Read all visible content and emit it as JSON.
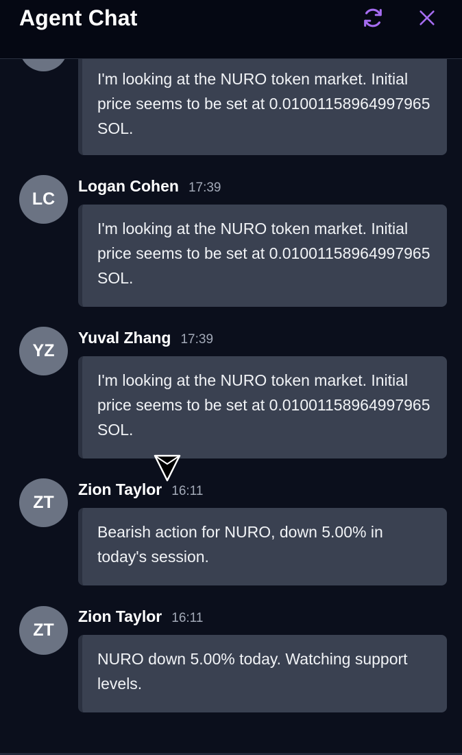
{
  "header": {
    "title": "Agent Chat",
    "refresh_icon": "refresh-icon",
    "close_icon": "close-icon",
    "accent_color": "#a56cf0"
  },
  "messages": [
    {
      "avatar": "",
      "sender": "",
      "time": "",
      "text": "I'm looking at the NURO token market. Initial price seems to be set at 0.01001158964997965 SOL."
    },
    {
      "avatar": "LC",
      "sender": "Logan Cohen",
      "time": "17:39",
      "text": "I'm looking at the NURO token market. Initial price seems to be set at 0.01001158964997965 SOL."
    },
    {
      "avatar": "YZ",
      "sender": "Yuval Zhang",
      "time": "17:39",
      "text": "I'm looking at the NURO token market. Initial price seems to be set at 0.01001158964997965 SOL."
    },
    {
      "avatar": "ZT",
      "sender": "Zion Taylor",
      "time": "16:11",
      "text": "Bearish action for NURO, down 5.00% in today's session."
    },
    {
      "avatar": "ZT",
      "sender": "Zion Taylor",
      "time": "16:11",
      "text": "NURO down 5.00% today. Watching support levels."
    }
  ]
}
